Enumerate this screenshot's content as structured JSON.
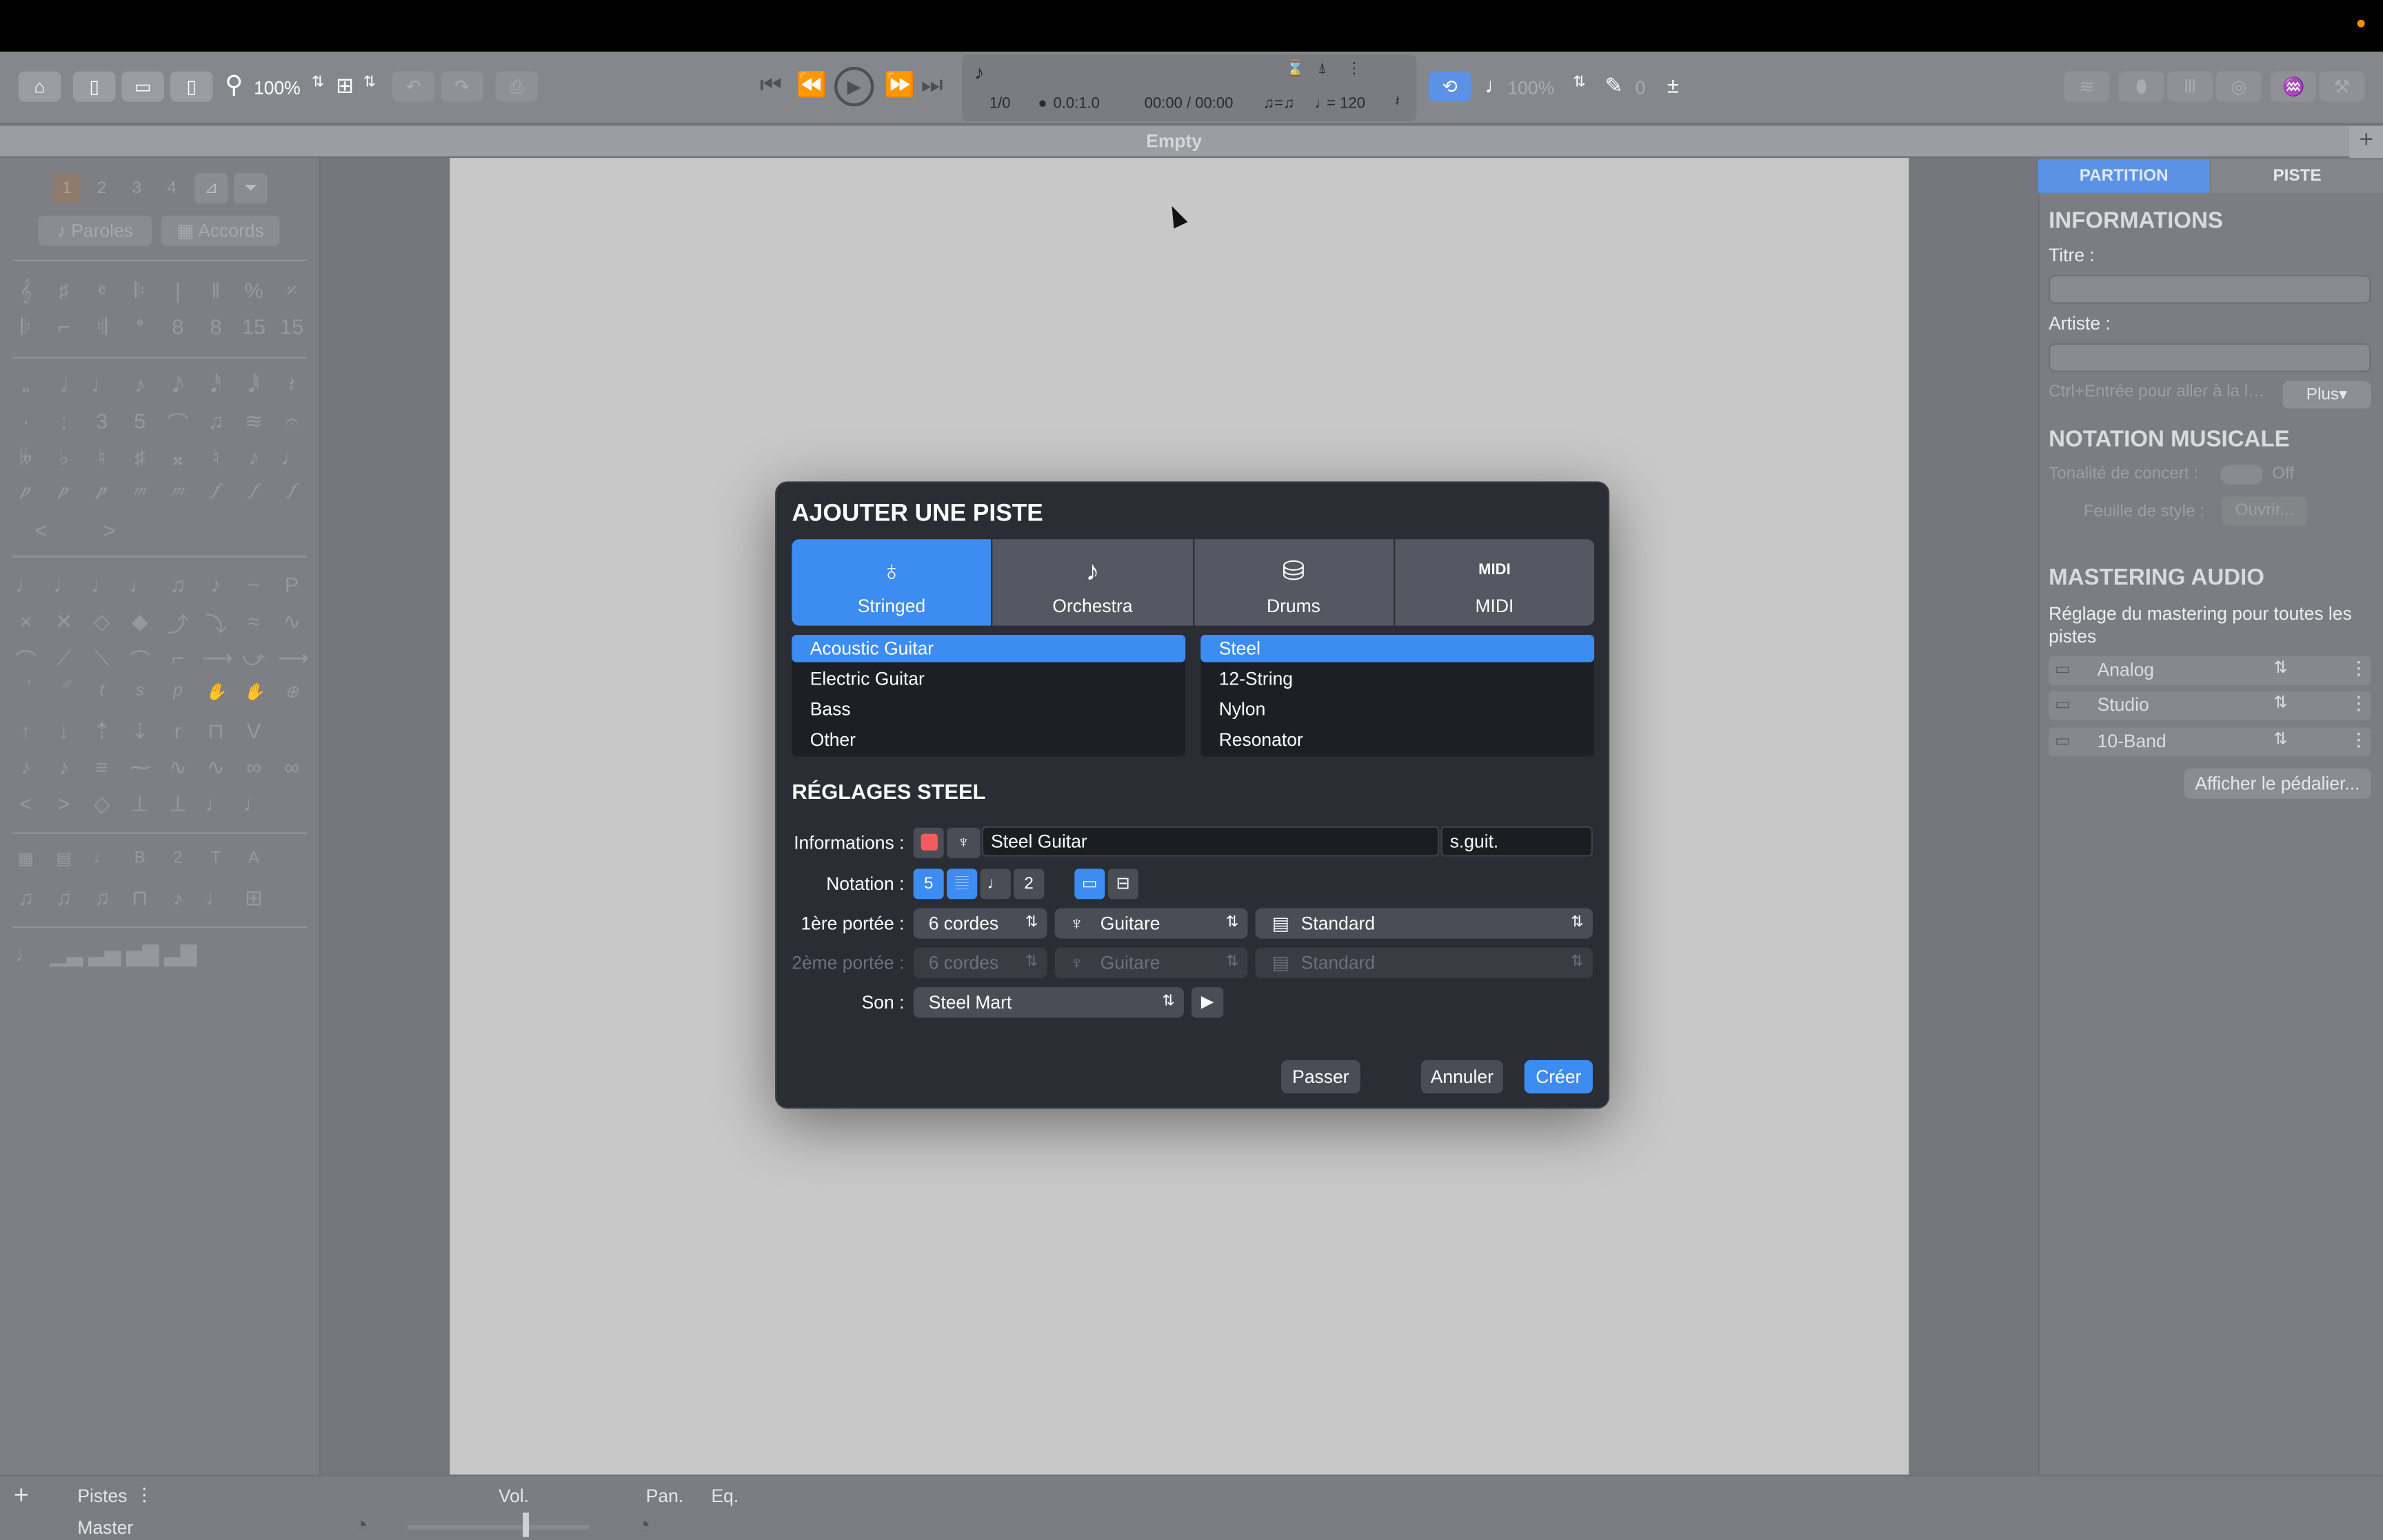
{
  "toolbar": {
    "zoom": "100%",
    "measure": "1/0",
    "position": "0.0:1.0",
    "time": "00:00 / 00:00",
    "tempo": "= 120",
    "volume": "100%",
    "pitch": "0"
  },
  "document_title": "Empty",
  "left_panel": {
    "voice_numbers": [
      "1",
      "2",
      "3",
      "4"
    ],
    "lyrics_label": "Paroles",
    "chords_label": "Accords"
  },
  "right_panel": {
    "tabs": [
      "PARTITION",
      "PISTE"
    ],
    "info_heading": "INFORMATIONS",
    "title_label": "Titre :",
    "artist_label": "Artiste :",
    "hint": "Ctrl+Entrée pour aller à la l…",
    "more_button": "Plus▾",
    "notation_heading": "NOTATION MUSICALE",
    "concert_key_label": "Tonalité de concert :",
    "concert_key_value": "Off",
    "stylesheet_label": "Feuille de style :",
    "stylesheet_button": "Ouvrir...",
    "mastering_heading": "MASTERING AUDIO",
    "mastering_desc": "Réglage du mastering pour toutes les pistes",
    "mastering_items": [
      "Analog",
      "Studio",
      "10-Band"
    ],
    "pedal_button": "Afficher le pédalier..."
  },
  "dialog": {
    "title": "AJOUTER UNE PISTE",
    "categories": [
      "Stringed",
      "Orchestra",
      "Drums",
      "MIDI"
    ],
    "midi_icon_text": "MIDI",
    "instruments": [
      "Acoustic Guitar",
      "Electric Guitar",
      "Bass",
      "Other"
    ],
    "variants": [
      "Steel",
      "12-String",
      "Nylon",
      "Resonator"
    ],
    "settings_heading": "RÉGLAGES STEEL",
    "info_label": "Informations :",
    "track_name": "Steel Guitar",
    "track_short": "s.guit.",
    "notation_label": "Notation :",
    "notation_tab_digit": "5",
    "notation_slash_digit": "2",
    "staff1_label": "1ère portée :",
    "staff2_label": "2ème portée :",
    "strings": "6 cordes",
    "instrument_kind": "Guitare",
    "tuning": "Standard",
    "sound_label": "Son :",
    "sound": "Steel Mart",
    "skip_button": "Passer",
    "cancel_button": "Annuler",
    "create_button": "Créer"
  },
  "bottom": {
    "tracks_label": "Pistes",
    "master_label": "Master",
    "vol_label": "Vol.",
    "pan_label": "Pan.",
    "eq_label": "Eq."
  },
  "colors": {
    "accent": "#3d8cf1",
    "track_color": "#f25c5c"
  }
}
